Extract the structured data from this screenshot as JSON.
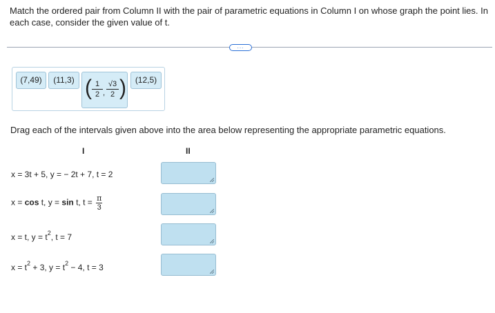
{
  "instructions": "Match the ordered pair from Column II with the pair of parametric equations in Column I on whose graph the point lies. In each case, consider the given value of t.",
  "more_button": "...",
  "tiles": {
    "t1": "(7,49)",
    "t2": "(11,3)",
    "t3": {
      "num1": "1",
      "den1": "2",
      "num2": "√3",
      "den2": "2",
      "comma": ","
    },
    "t4": "(12,5)"
  },
  "prompt": "Drag each of the intervals given above into the area below representing the appropriate parametric equations.",
  "columns": {
    "col1": "I",
    "col2": "II"
  },
  "equations": {
    "e1": "x = 3t + 5, y = − 2t + 7, t = 2",
    "e2": {
      "part1": "x = ",
      "cos": "cos",
      "part2": " t, y = ",
      "sin": "sin",
      "part3": " t, t = ",
      "pi_num": "π",
      "pi_den": "3"
    },
    "e3": {
      "part1": "x = t, y = t",
      "sup": "2",
      "part2": ", t = 7"
    },
    "e4": {
      "part1": "x = t",
      "sup1": "2",
      "part2": " + 3, y = t",
      "sup2": "2",
      "part3": " − 4, t = 3"
    }
  }
}
